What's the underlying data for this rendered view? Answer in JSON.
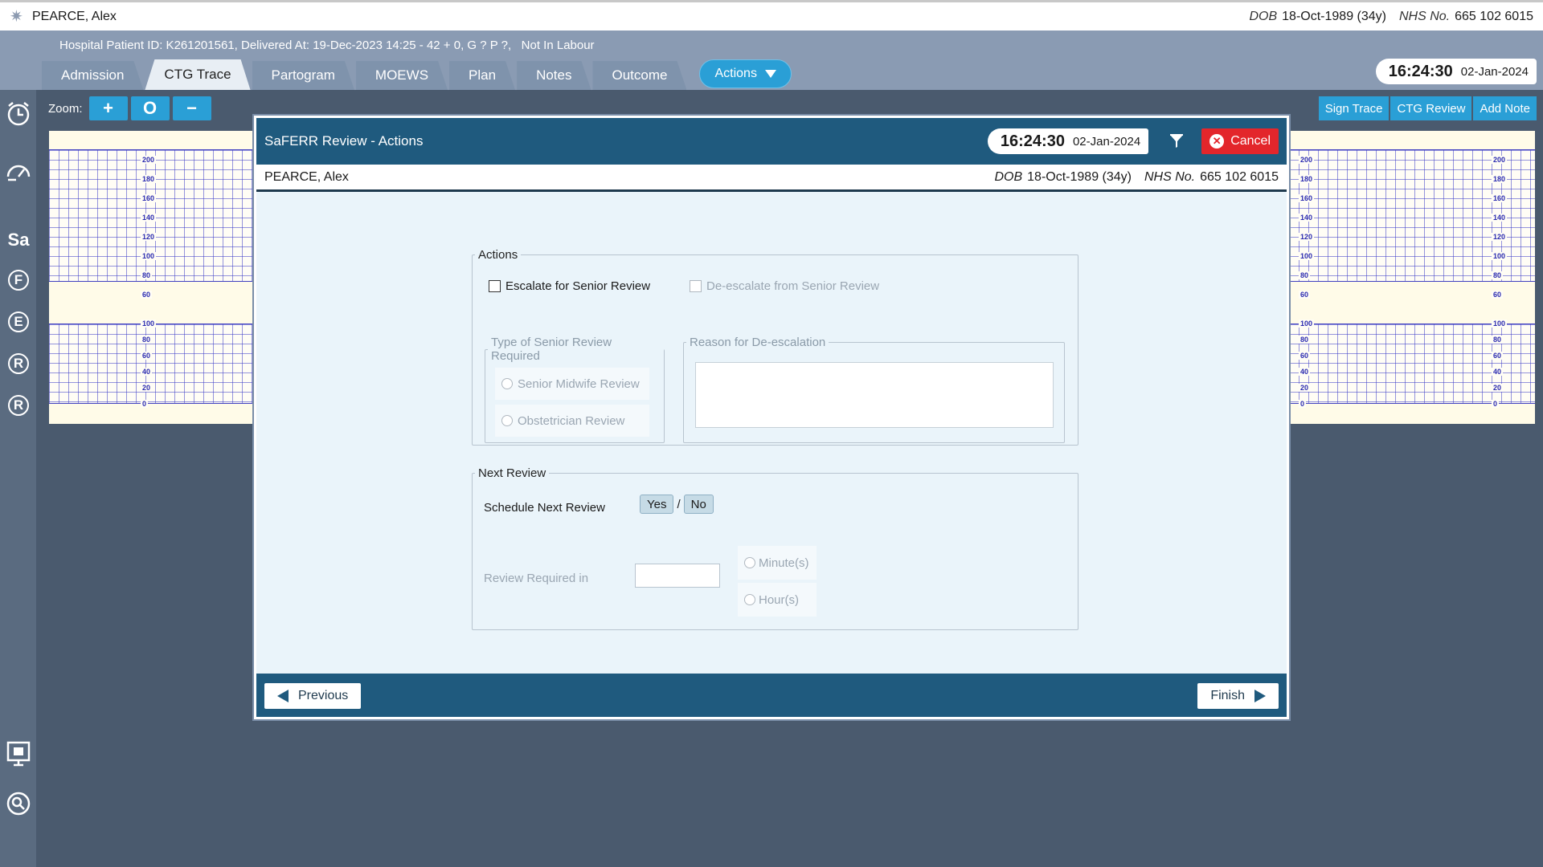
{
  "patient": {
    "name": "PEARCE, Alex",
    "dob_label": "DOB",
    "dob": "18-Oct-1989 (34y)",
    "nhs_label": "NHS No.",
    "nhs": "665 102 6015"
  },
  "header": {
    "info": "Hospital Patient ID: K261201561, Delivered At: 19-Dec-2023 14:25 - 42 + 0, G ? P ?,   Not In Labour",
    "tabs": [
      "Admission",
      "CTG Trace",
      "Partogram",
      "MOEWS",
      "Plan",
      "Notes",
      "Outcome"
    ],
    "active_tab": "CTG Trace",
    "actions_label": "Actions",
    "time": "16:24:30",
    "date": "02-Jan-2024"
  },
  "sidebar": {
    "letters": [
      "Sa",
      "F",
      "E",
      "R",
      "R"
    ]
  },
  "toolbar": {
    "zoom_label": "Zoom:",
    "zoom_in": "+",
    "zoom_reset": "O",
    "zoom_out": "−",
    "sign_trace": "Sign Trace",
    "ctg_review": "CTG Review",
    "add_note": "Add Note"
  },
  "ctg": {
    "fhr_scale": [
      "200",
      "180",
      "160",
      "140",
      "120",
      "100",
      "80",
      "60"
    ],
    "toco_scale": [
      "100",
      "80",
      "60",
      "40",
      "20",
      "0"
    ]
  },
  "modal": {
    "title": "SaFERR Review - Actions",
    "time": "16:24:30",
    "date": "02-Jan-2024",
    "cancel_label": "Cancel",
    "actions": {
      "legend": "Actions",
      "escalate_label": "Escalate for Senior Review",
      "deescalate_label": "De-escalate from Senior Review",
      "type_legend": "Type of Senior Review Required",
      "midwife_label": "Senior Midwife Review",
      "obstetrician_label": "Obstetrician Review",
      "reason_legend": "Reason for De-escalation"
    },
    "next_review": {
      "legend": "Next Review",
      "schedule_label": "Schedule Next Review",
      "yes": "Yes",
      "sep": "/",
      "no": "No",
      "required_label": "Review Required in",
      "minutes_label": "Minute(s)",
      "hours_label": "Hour(s)"
    },
    "previous_label": "Previous",
    "finish_label": "Finish"
  }
}
